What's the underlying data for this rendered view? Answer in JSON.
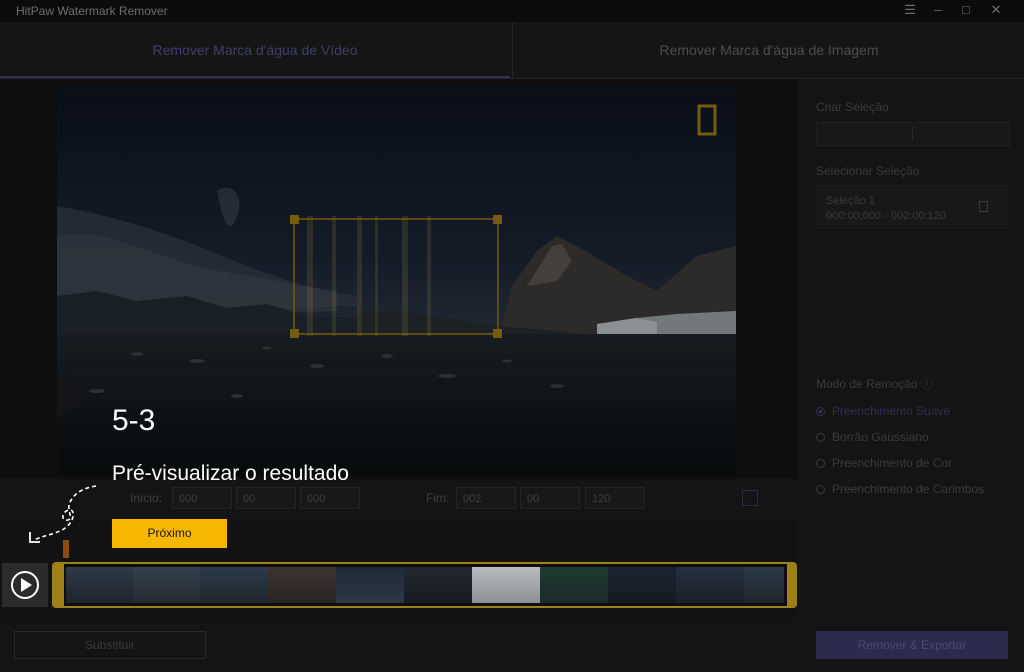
{
  "window": {
    "title": "HitPaw Watermark Remover",
    "controls": [
      "menu-icon",
      "minimize-icon",
      "maximize-icon",
      "close-icon"
    ]
  },
  "tabs": [
    {
      "label": "Remover Marca d'água de Vídeo",
      "active": true
    },
    {
      "label": "Remover Marca d'água de Imagem",
      "active": false
    }
  ],
  "timing": {
    "start_label": "Início:",
    "start_h": "000",
    "start_m": "00",
    "start_s": "000",
    "end_label": "Fim:",
    "end_h": "002",
    "end_m": "00",
    "end_s": "120"
  },
  "sidebar": {
    "create_label": "Criar Seleção",
    "select_label": "Selecionar Seleção",
    "selection": {
      "name": "Seleção 1",
      "range": "000:00:000 - 002:00:120"
    },
    "mode_label": "Modo de Remoção ⓘ",
    "modes": [
      {
        "label": "Preenchimento Suave",
        "selected": true
      },
      {
        "label": "Borrão Gaussiano",
        "selected": false
      },
      {
        "label": "Preenchimento de Cor",
        "selected": false
      },
      {
        "label": "Preenchimento de Carimbos",
        "selected": false
      }
    ]
  },
  "guide": {
    "step": "5-3",
    "text": "Pré-visualizar o resultado",
    "next": "Próximo"
  },
  "bottom": {
    "replace_label": "Substituir",
    "export_label": "Remover & Exportar"
  },
  "colors": {
    "accent": "#f5b700",
    "timeline_border": "#a08018",
    "export_bg": "#2c2b4d"
  }
}
